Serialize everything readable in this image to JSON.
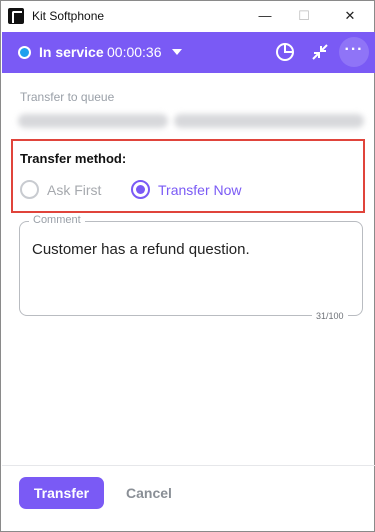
{
  "window": {
    "title": "Kit Softphone",
    "controls": {
      "minimize": "—",
      "maximize": "☐",
      "close": "✕"
    }
  },
  "status": {
    "label": "In service",
    "timer": "00:00:36",
    "dot_color": "#1fa0ee",
    "accent_color": "#7a5af5",
    "icons": [
      "pie-chart-icon",
      "collapse-icon",
      "more-icon"
    ]
  },
  "transfer": {
    "queue_label": "Transfer to queue",
    "method_label": "Transfer method:",
    "options": [
      {
        "label": "Ask First",
        "selected": false
      },
      {
        "label": "Transfer Now",
        "selected": true
      }
    ]
  },
  "comment": {
    "legend": "Comment",
    "value": "Customer has a refund question.",
    "count": "31/100"
  },
  "footer": {
    "transfer_label": "Transfer",
    "cancel_label": "Cancel"
  }
}
